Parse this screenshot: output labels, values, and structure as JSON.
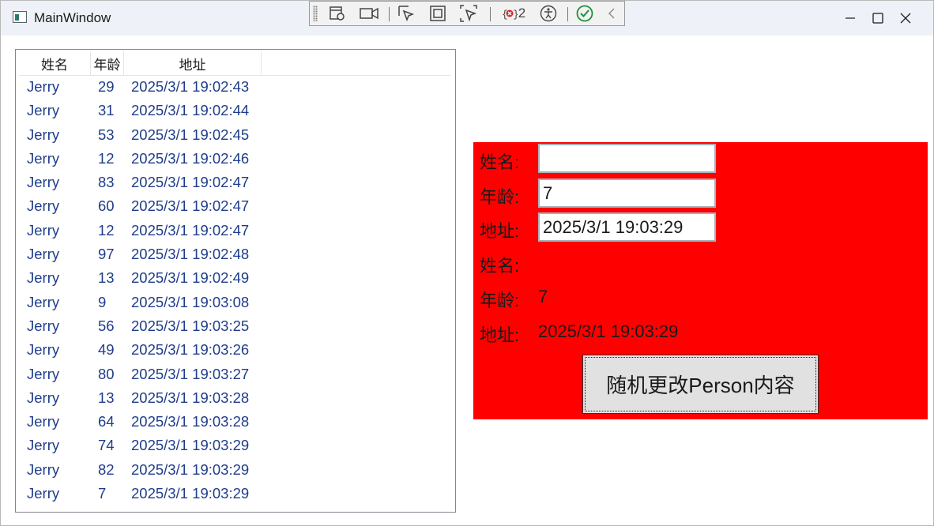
{
  "window": {
    "title": "MainWindow"
  },
  "toolbar": {
    "error_count": "2"
  },
  "list": {
    "columns": [
      "姓名",
      "年龄",
      "地址"
    ],
    "rows": [
      {
        "name": "Jerry",
        "age": "29",
        "address": "2025/3/1 19:02:43"
      },
      {
        "name": "Jerry",
        "age": "31",
        "address": "2025/3/1 19:02:44"
      },
      {
        "name": "Jerry",
        "age": "53",
        "address": "2025/3/1 19:02:45"
      },
      {
        "name": "Jerry",
        "age": "12",
        "address": "2025/3/1 19:02:46"
      },
      {
        "name": "Jerry",
        "age": "83",
        "address": "2025/3/1 19:02:47"
      },
      {
        "name": "Jerry",
        "age": "60",
        "address": "2025/3/1 19:02:47"
      },
      {
        "name": "Jerry",
        "age": "12",
        "address": "2025/3/1 19:02:47"
      },
      {
        "name": "Jerry",
        "age": "97",
        "address": "2025/3/1 19:02:48"
      },
      {
        "name": "Jerry",
        "age": "13",
        "address": "2025/3/1 19:02:49"
      },
      {
        "name": "Jerry",
        "age": "9",
        "address": "2025/3/1 19:03:08"
      },
      {
        "name": "Jerry",
        "age": "56",
        "address": "2025/3/1 19:03:25"
      },
      {
        "name": "Jerry",
        "age": "49",
        "address": "2025/3/1 19:03:26"
      },
      {
        "name": "Jerry",
        "age": "80",
        "address": "2025/3/1 19:03:27"
      },
      {
        "name": "Jerry",
        "age": "13",
        "address": "2025/3/1 19:03:28"
      },
      {
        "name": "Jerry",
        "age": "64",
        "address": "2025/3/1 19:03:28"
      },
      {
        "name": "Jerry",
        "age": "74",
        "address": "2025/3/1 19:03:29"
      },
      {
        "name": "Jerry",
        "age": "82",
        "address": "2025/3/1 19:03:29"
      },
      {
        "name": "Jerry",
        "age": "7",
        "address": "2025/3/1 19:03:29"
      }
    ]
  },
  "form": {
    "name_label": "姓名:",
    "age_label": "年龄:",
    "address_label": "地址:",
    "name_value": "",
    "age_value": "7",
    "address_value": "2025/3/1 19:03:29",
    "display_name_label": "姓名:",
    "display_age_label": "年龄:",
    "display_address_label": "地址:",
    "display_name": "",
    "display_age": "7",
    "display_address": "2025/3/1 19:03:29",
    "button_label": "随机更改Person内容",
    "panel_color": "#ff0000"
  }
}
